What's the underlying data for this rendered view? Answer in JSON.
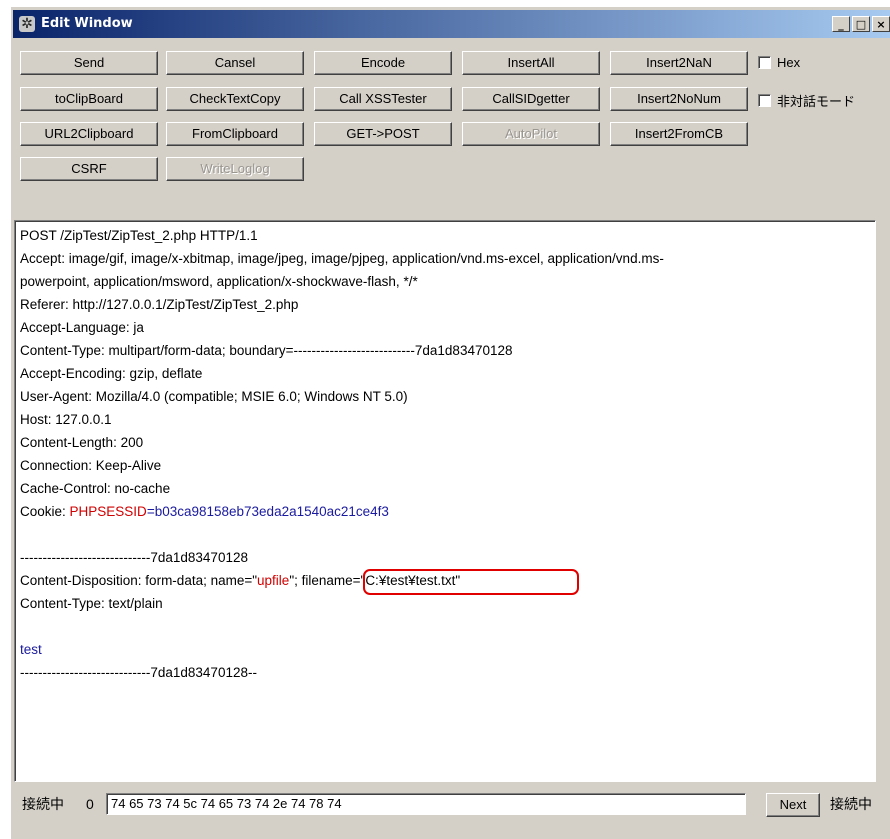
{
  "window": {
    "title": "Edit Window",
    "controls": [
      "_",
      "□",
      "×"
    ]
  },
  "toolbar": {
    "row1": [
      "Send",
      "Cansel",
      "Encode",
      "InsertAll",
      "Insert2NaN"
    ],
    "row2": [
      "toClipBoard",
      "CheckTextCopy",
      "Call XSSTester",
      "CallSIDgetter",
      "Insert2NoNum"
    ],
    "row3": [
      "URL2Clipboard",
      "FromClipboard",
      "GET->POST",
      "AutoPilot",
      "Insert2FromCB"
    ],
    "row4": [
      "CSRF",
      "WriteLoglog"
    ],
    "checkbox_hex": "Hex",
    "checkbox_nondialog": "非対話モード"
  },
  "request": {
    "lines": [
      "POST /ZipTest/ZipTest_2.php HTTP/1.1",
      "Accept: image/gif, image/x-xbitmap, image/jpeg, image/pjpeg, application/vnd.ms-excel, application/vnd.ms-",
      "powerpoint, application/msword, application/x-shockwave-flash, */*",
      "Referer: http://127.0.0.1/ZipTest/ZipTest_2.php",
      "Accept-Language: ja",
      "Content-Type: multipart/form-data; boundary=---------------------------7da1d83470128",
      "Accept-Encoding: gzip, deflate",
      "User-Agent: Mozilla/4.0 (compatible; MSIE 6.0; Windows NT 5.0)",
      "Host: 127.0.0.1",
      "Content-Length: 200",
      "Connection: Keep-Alive",
      "Cache-Control: no-cache"
    ],
    "cookie_prefix": "Cookie: ",
    "cookie_name": "PHPSESSID",
    "cookie_value": "=b03ca98158eb73eda2a1540ac21ce4f3",
    "boundary_line": "-----------------------------7da1d83470128",
    "cd_prefix": "Content-Disposition: form-data; name=\"",
    "cd_name": "upfile",
    "cd_sep": "\"; ",
    "cd_filename": "filename=\"C:¥test¥test.txt\"",
    "content_type": "Content-Type: text/plain",
    "body": "test",
    "boundary_end": "-----------------------------7da1d83470128--"
  },
  "statusbar": {
    "status_left": "接続中",
    "counter": "0",
    "hex_value": "74 65 73 74 5c 74 65 73 74 2e 74 78 74",
    "next_label": "Next",
    "status_right": "接続中"
  }
}
